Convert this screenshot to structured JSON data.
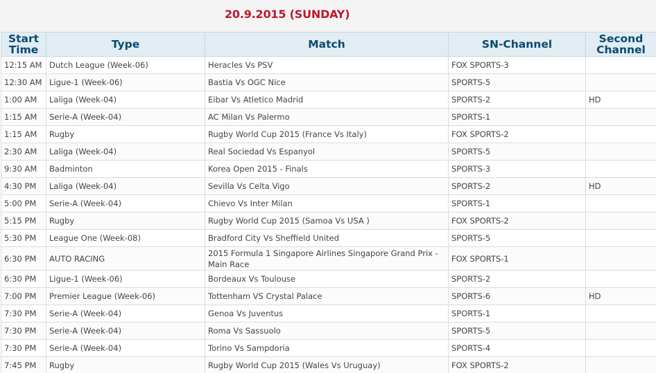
{
  "date_title": "20.9.2015 (SUNDAY)",
  "columns": {
    "start_line1": "Start",
    "start_line2": "Time",
    "type": "Type",
    "match": "Match",
    "sn_channel": "SN-Channel",
    "second_line1": "Second",
    "second_line2": "Channel"
  },
  "rows": [
    {
      "time": "12:15 AM",
      "type": "Dutch League (Week-06)",
      "match": "Heracles Vs PSV",
      "channel": "FOX SPORTS-3",
      "second": ""
    },
    {
      "time": "12:30 AM",
      "type": "Ligue-1 (Week-06)",
      "match": "Bastia Vs OGC Nice",
      "channel": "SPORTS-5",
      "second": ""
    },
    {
      "time": "1:00 AM",
      "type": "Laliga (Week-04)",
      "match": "Eibar Vs Atletico Madrid",
      "channel": "SPORTS-2",
      "second": "HD"
    },
    {
      "time": "1:15 AM",
      "type": "Serie-A (Week-04)",
      "match": "AC Milan Vs Palermo",
      "channel": "SPORTS-1",
      "second": ""
    },
    {
      "time": "1:15 AM",
      "type": "Rugby",
      "match": "Rugby World Cup 2015 (France Vs Italy)",
      "channel": "FOX SPORTS-2",
      "second": ""
    },
    {
      "time": "2:30 AM",
      "type": "Laliga (Week-04)",
      "match": "Real Sociedad Vs Espanyol",
      "channel": "SPORTS-5",
      "second": ""
    },
    {
      "time": "9:30 AM",
      "type": "Badminton",
      "match": "Korea Open 2015 - Finals",
      "channel": "SPORTS-3",
      "second": ""
    },
    {
      "time": "4:30 PM",
      "type": "Laliga (Week-04)",
      "match": "Sevilla Vs Celta Vigo",
      "channel": "SPORTS-2",
      "second": "HD"
    },
    {
      "time": "5:00 PM",
      "type": "Serie-A (Week-04)",
      "match": "Chievo Vs Inter Milan",
      "channel": "SPORTS-1",
      "second": ""
    },
    {
      "time": "5:15 PM",
      "type": "Rugby",
      "match": "Rugby World Cup 2015 (Samoa Vs USA )",
      "channel": "FOX SPORTS-2",
      "second": ""
    },
    {
      "time": "5:30 PM",
      "type": "League One (Week-08)",
      "match": "Bradford City Vs Sheffield United",
      "channel": "SPORTS-5",
      "second": ""
    },
    {
      "time": "6:30 PM",
      "type": "AUTO RACING",
      "match": "2015 Formula 1 Singapore Airlines Singapore Grand Prix - Main Race",
      "channel": "FOX SPORTS-1",
      "second": ""
    },
    {
      "time": "6:30 PM",
      "type": "Ligue-1 (Week-06)",
      "match": "Bordeaux Vs Toulouse",
      "channel": "SPORTS-2",
      "second": ""
    },
    {
      "time": "7:00 PM",
      "type": "Premier League (Week-06)",
      "match": "Tottenham VS Crystal Palace",
      "channel": "SPORTS-6",
      "second": "HD"
    },
    {
      "time": "7:30 PM",
      "type": "Serie-A (Week-04)",
      "match": "Genoa Vs Juventus",
      "channel": "SPORTS-1",
      "second": ""
    },
    {
      "time": "7:30 PM",
      "type": "Serie-A (Week-04)",
      "match": "Roma Vs Sassuolo",
      "channel": "SPORTS-5",
      "second": ""
    },
    {
      "time": "7:30 PM",
      "type": "Serie-A (Week-04)",
      "match": "Torino Vs Sampdoria",
      "channel": "SPORTS-4",
      "second": ""
    },
    {
      "time": "7:45 PM",
      "type": "Rugby",
      "match": "Rugby World Cup 2015 (Wales Vs Uruguay)",
      "channel": "FOX SPORTS-2",
      "second": ""
    }
  ]
}
